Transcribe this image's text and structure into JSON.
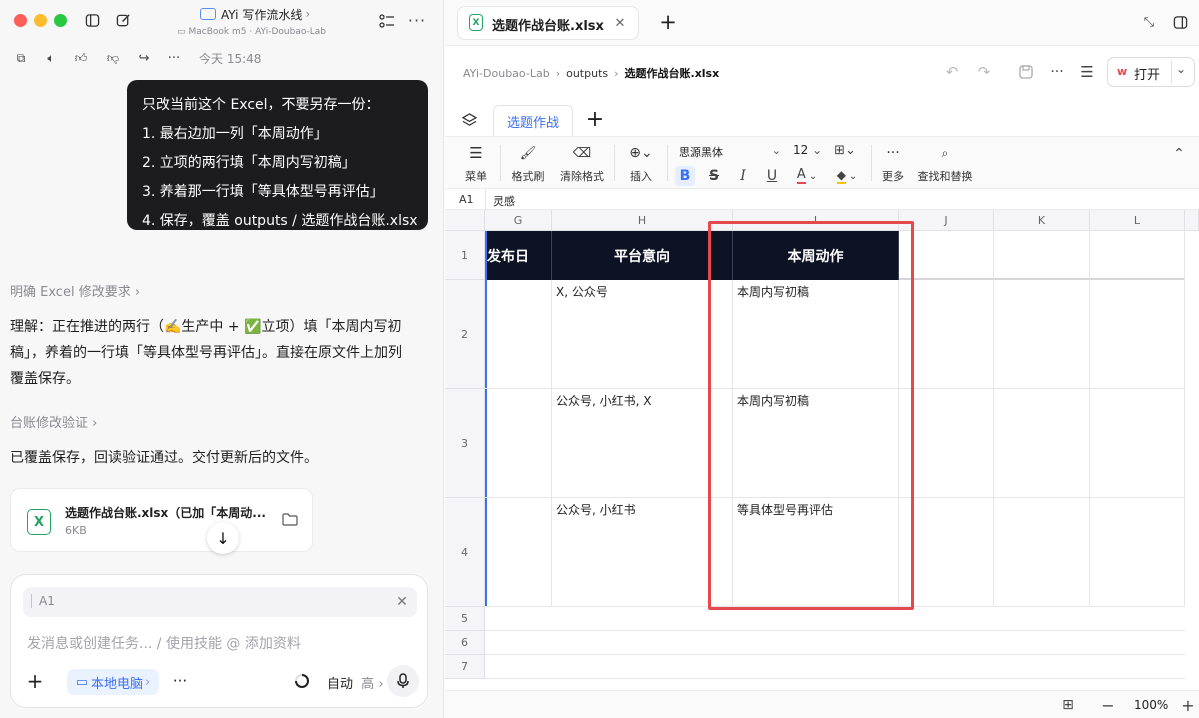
{
  "window": {
    "title": "AYi 写作流水线",
    "subtitle": "MacBook m5 · AYi-Doubao-Lab"
  },
  "chat": {
    "timestamp": "今天 15:48",
    "user_message": [
      "只改当前这个 Excel，不要另存一份：",
      "1. 最右边加一列「本周动作」",
      "2. 立项的两行填「本周内写初稿」",
      "3. 养着那一行填「等具体型号再评估」",
      "4. 保存，覆盖 outputs / 选题作战台账.xlsx"
    ],
    "step1_label": "明确 Excel 修改要求",
    "understanding": [
      "理解：正在推进的两行（✍️生产中 + ✅立项）填「本周内写初",
      "稿」，养着的一行填「等具体型号再评估」。直接在原文件上加列",
      "覆盖保存。"
    ],
    "step2_label": "台账修改验证",
    "result": "已覆盖保存，回读验证通过。交付更新后的文件。",
    "file": {
      "name": "选题作战台账.xlsx（已加「本周动...",
      "size": "6KB"
    }
  },
  "composer": {
    "reference": "A1",
    "placeholder": "发消息或创建任务... / 使用技能 @ 添加资料",
    "device": "本地电脑",
    "mode": "自动",
    "level": "高"
  },
  "editor": {
    "tab_title": "选题作战台账.xlsx",
    "breadcrumb": [
      "AYi-Doubao-Lab",
      "outputs",
      "选题作战台账.xlsx"
    ],
    "open_label": "打开",
    "sheet_tab": "选题作战",
    "toolbar": {
      "menu": "菜单",
      "format_painter": "格式刷",
      "clear_format": "清除格式",
      "insert": "插入",
      "font": "思源黑体",
      "font_size": "12",
      "more": "更多",
      "find_replace": "查找和替换"
    },
    "cell_ref": "A1",
    "formula_value": "灵感",
    "zoom": "100%"
  },
  "sheet": {
    "columns": [
      "G",
      "H",
      "I",
      "J",
      "K",
      "L"
    ],
    "rows": [
      "1",
      "2",
      "3",
      "4",
      "5",
      "6",
      "7"
    ],
    "header": [
      "发布日",
      "平台意向",
      "本周动作"
    ],
    "data": [
      {
        "platform": "X, 公众号",
        "action": "本周内写初稿"
      },
      {
        "platform": "公众号, 小红书, X",
        "action": "本周内写初稿"
      },
      {
        "platform": "公众号, 小红书",
        "action": "等具体型号再评估"
      }
    ]
  },
  "colors": {
    "header_fill": "#0d1324",
    "highlight": "#e5484d",
    "accent": "#3a6ff7"
  }
}
